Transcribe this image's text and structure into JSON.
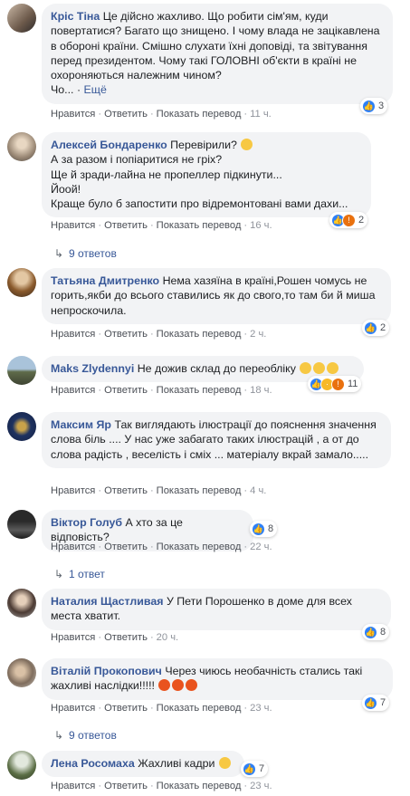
{
  "comments": [
    {
      "author": "Кріс Тіна",
      "text": "Це дійсно жахливо. Що робити сім'ям, куди повертатися? Багато що знищено. І чому влада не зацікавлена в обороні країни. Смішно слухати їхні доповіді, та звітування перед президентом. Чому такі ГОЛОВНІ об'єкти в країні не охороняються належним чином?",
      "tail": "Чо...",
      "more": "Ещё",
      "like": "Нравится",
      "reply": "Ответить",
      "translate": "Показать перевод",
      "time": "11 ч.",
      "reactions": "3"
    },
    {
      "author": "Алексей Бондаренко",
      "line1": "Перевірили?",
      "line2": "А за разом і попіаритися не гріх?",
      "line3": "Ще й зради-лайна не пропеллер підкинути...",
      "line4": "Йоой!",
      "line5": "Краще було б запостити про відремонтовані вами дахи...",
      "like": "Нравится",
      "reply": "Ответить",
      "translate": "Показать перевод",
      "time": "16 ч.",
      "reactions": "2",
      "replies": "9 ответов"
    },
    {
      "author": "Татьяна Дмитренко",
      "text": "Нема хазяїна в країні,Рошен чомусь не горить,якби до всього ставились як до свого,то там би й миша непроскочила.",
      "like": "Нравится",
      "reply": "Ответить",
      "translate": "Показать перевод",
      "time": "2 ч.",
      "reactions": "2"
    },
    {
      "author": "Maks Zlydennyi",
      "text": "Не дожив склад до переобліку",
      "like": "Нравится",
      "reply": "Ответить",
      "translate": "Показать перевод",
      "time": "18 ч.",
      "reactions": "11"
    },
    {
      "author": "Максим Яр",
      "text": "Так виглядають ілюстрації до пояснення значення слова біль .... У нас уже забагато таких ілюстрацій , а от до слова радість , веселість і сміх ... матеріалу вкрай замало.....",
      "like": "Нравится",
      "reply": "Ответить",
      "translate": "Показать перевод",
      "time": "4 ч."
    },
    {
      "author": "Віктор Голуб",
      "text": "А хто за це відповість?",
      "like": "Нравится",
      "reply": "Ответить",
      "translate": "Показать перевод",
      "time": "22 ч.",
      "reactions": "8",
      "replies": "1 ответ"
    },
    {
      "author": "Наталия Щастливая",
      "text": "У Пети Порошенко в доме для всех места хватит.",
      "like": "Нравится",
      "reply": "Ответить",
      "time": "20 ч.",
      "reactions": "8"
    },
    {
      "author": "Віталій Прокопович",
      "text": "Через чиюсь необачність стались такі жахливі наслідки!!!!!",
      "like": "Нравится",
      "reply": "Ответить",
      "translate": "Показать перевод",
      "time": "23 ч.",
      "reactions": "7",
      "replies": "9 ответов"
    },
    {
      "author": "Лена Росомаха",
      "text": "Жахливі кадри",
      "like": "Нравится",
      "reply": "Ответить",
      "translate": "Показать перевод",
      "time": "23 ч.",
      "reactions": "7"
    }
  ],
  "colors": {
    "link": "#385898",
    "bubble": "#f2f3f5",
    "like": "#2e80f6"
  }
}
